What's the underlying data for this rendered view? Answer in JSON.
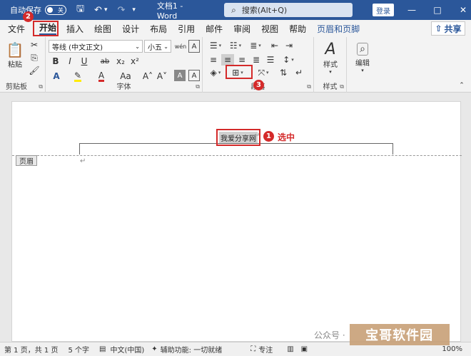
{
  "titlebar": {
    "autosave_label": "自动保存",
    "toggle_state": "关",
    "doc_title": "文档1 - Word",
    "search_placeholder": "搜索(Alt+Q)",
    "login_label": "登录",
    "minimize": "—",
    "maximize": "□",
    "close": "✕"
  },
  "menu": {
    "tabs": [
      "文件",
      "开始",
      "插入",
      "绘图",
      "设计",
      "布局",
      "引用",
      "邮件",
      "审阅",
      "视图",
      "帮助",
      "页眉和页脚"
    ],
    "active": "开始",
    "share_label": "共享"
  },
  "ribbon": {
    "clipboard": {
      "paste_label": "粘贴",
      "group_label": "剪贴板"
    },
    "font": {
      "font_name": "等线 (中文正文)",
      "font_size": "小五",
      "group_label": "字体",
      "bold": "B",
      "italic": "I",
      "underline": "U",
      "strike": "ab",
      "sub": "x₂",
      "sup": "x²",
      "color_a": "A",
      "size_aa": "Aa",
      "grow": "A˄",
      "shrink": "A˅",
      "clear": "A"
    },
    "paragraph": {
      "group_label": "段落"
    },
    "styles": {
      "label": "样式",
      "group_label": "样式"
    },
    "editing": {
      "label": "编辑"
    }
  },
  "document": {
    "selected_text": "我爱分享网",
    "header_tag": "页眉"
  },
  "annotations": {
    "step1": "1",
    "step1_text": "选中",
    "step2": "2",
    "step3": "3"
  },
  "status": {
    "page": "第 1 页，共 1 页",
    "words": "5 个字",
    "lang": "中文(中国)",
    "accessibility": "辅助功能: 一切就绪",
    "focus": "专注",
    "zoom": "100%"
  },
  "watermark": {
    "gzh": "公众号 ·",
    "logo": "宝哥软件园"
  },
  "colors": {
    "brand": "#2b579a",
    "annotation": "#d42a2a"
  }
}
